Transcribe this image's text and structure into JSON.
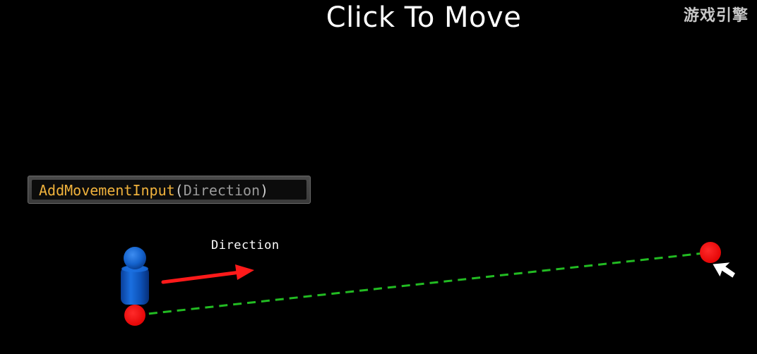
{
  "slide": {
    "title": "Click To Move",
    "watermark": "游戏引擎"
  },
  "code": {
    "function": "AddMovementInput",
    "open_paren": "(",
    "argument": "Direction",
    "close_paren": ")"
  },
  "diagram": {
    "direction_label": "Direction",
    "colors": {
      "character": "#1565c0",
      "point": "#ff0000",
      "arrow": "#ff1a1a",
      "path": "#22bb22",
      "cursor": "#ffffff"
    }
  }
}
